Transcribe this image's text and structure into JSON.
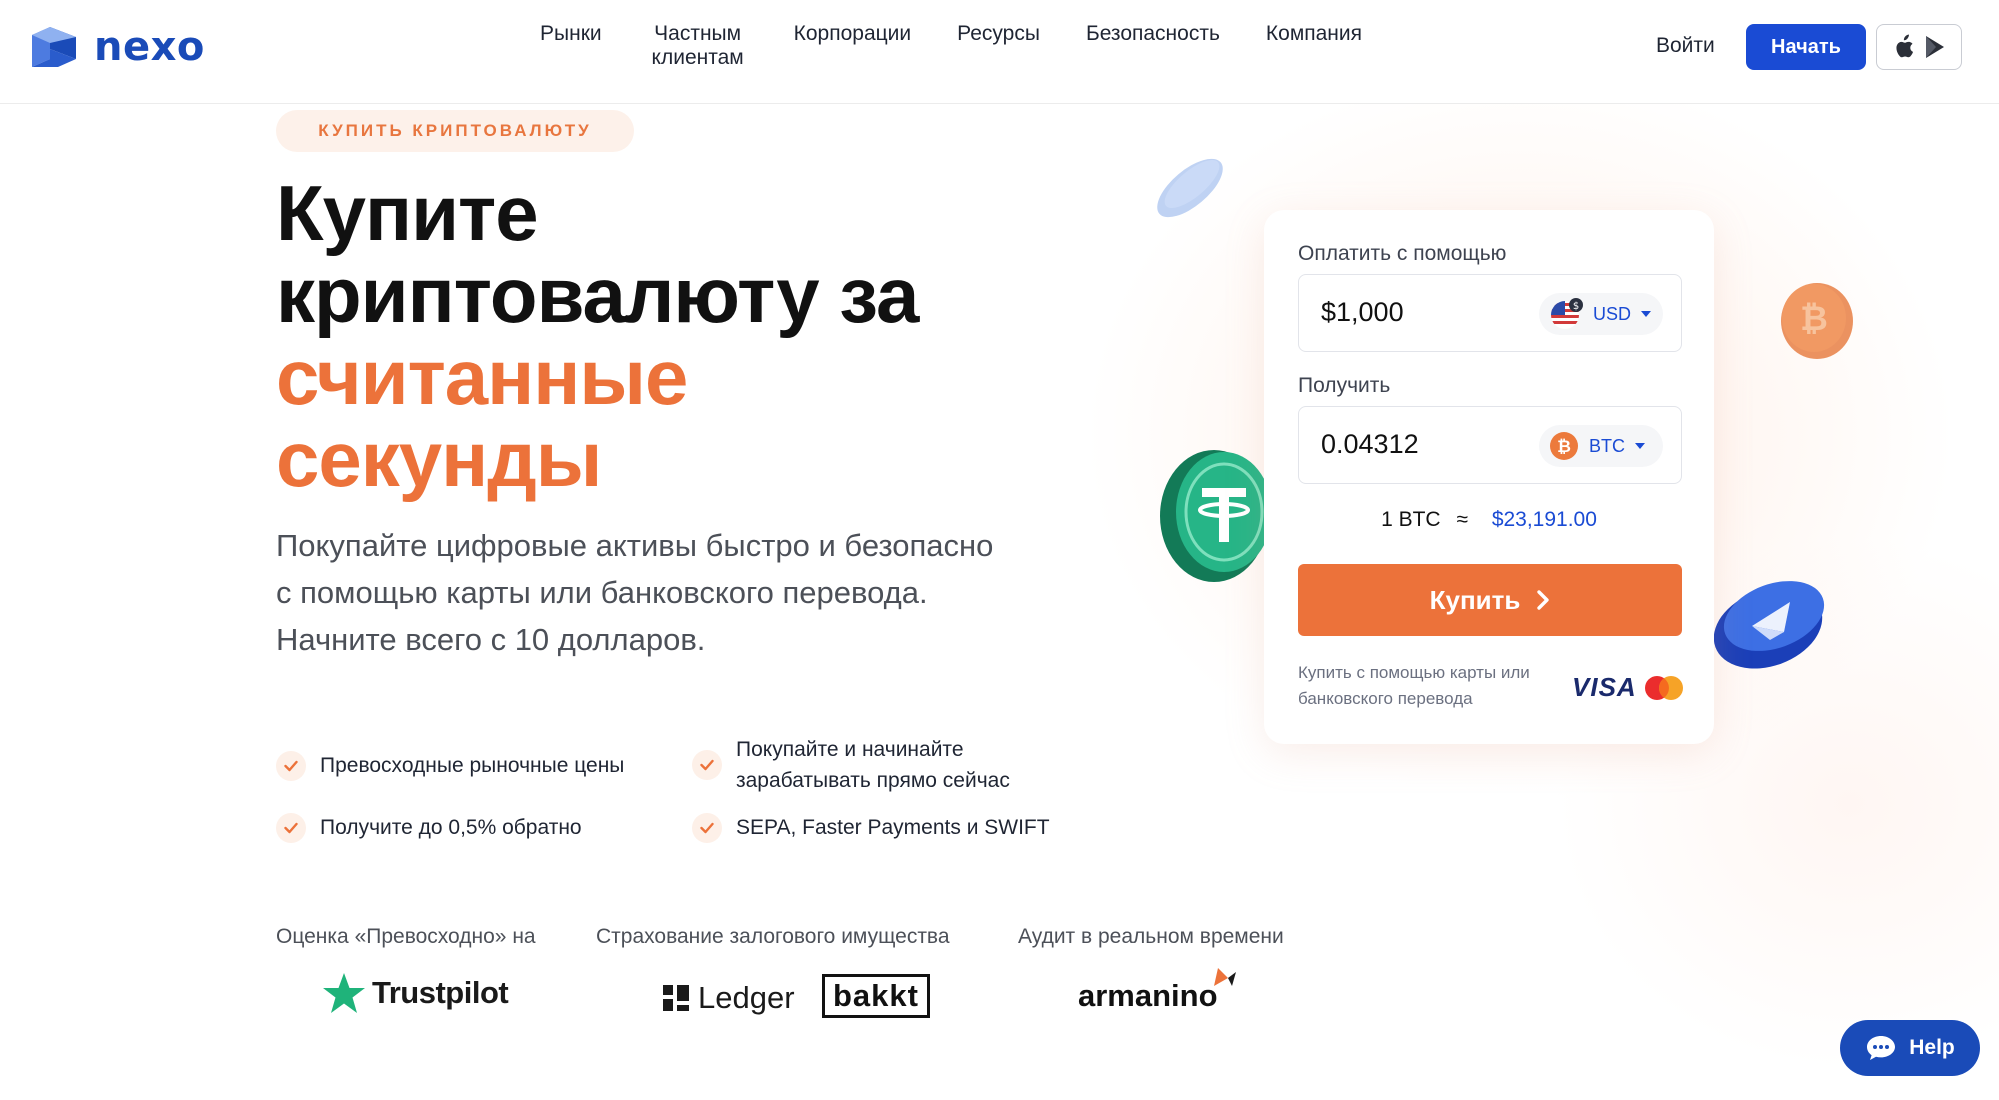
{
  "brand": {
    "name": "nexo"
  },
  "nav": {
    "items": [
      {
        "label": "Рынки"
      },
      {
        "label": "Частным клиентам"
      },
      {
        "label": "Корпорации"
      },
      {
        "label": "Ресурсы"
      },
      {
        "label": "Безопасность"
      },
      {
        "label": "Компания"
      }
    ],
    "login": "Войти",
    "start": "Начать",
    "store_icons": [
      "apple-icon",
      "google-play-icon"
    ]
  },
  "hero": {
    "tag": "КУПИТЬ КРИПТОВАЛЮТУ",
    "title_line1": "Купите",
    "title_line2": "криптовалюту за",
    "title_accent_line1": "считанные",
    "title_accent_line2": "секунды",
    "lead": "Покупайте цифровые активы быстро и безопасно с помощью карты или банковского перевода. Начните всего с 10 долларов.",
    "features": [
      "Превосходные рыночные цены",
      "Покупайте и начинайте зарабатывать прямо сейчас",
      "Получите до 0,5% обратно",
      "SEPA, Faster Payments и SWIFT"
    ]
  },
  "proof": {
    "rating_label": "Оценка «Превосходно» на",
    "rating_brand": "Trustpilot",
    "insurance_label": "Страхование залогового имущества",
    "insurance_brands": [
      "Ledger",
      "bakkt"
    ],
    "audit_label": "Аудит в реальном времени",
    "audit_brand": "armanino"
  },
  "widget": {
    "pay_label": "Оплатить с помощью",
    "pay_value": "$1,000",
    "pay_currency": "USD",
    "receive_label": "Получить",
    "receive_value": "0.04312",
    "receive_currency": "BTC",
    "rate_left": "1 BTC",
    "rate_sep": "≈",
    "rate_right": "$23,191.00",
    "buy_label": "Купить",
    "pay_note": "Купить с помощью карты или банковского перевода",
    "visa": "VISA"
  },
  "help": {
    "label": "Help"
  },
  "colors": {
    "accent": "#ec723a",
    "brand": "#1a4bd4",
    "text": "#1f2533"
  }
}
